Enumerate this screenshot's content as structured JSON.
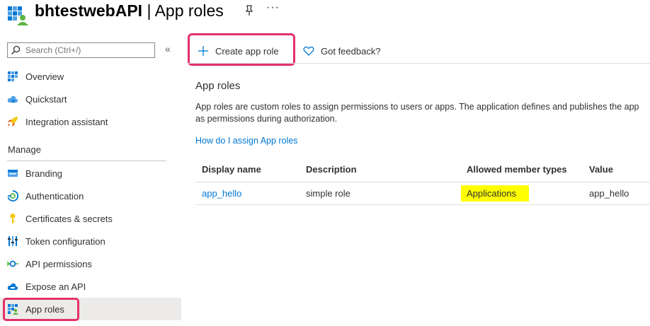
{
  "header": {
    "app_name": "bhtestwebAPI",
    "separator": " | ",
    "page_title": "App roles",
    "more_label": "···"
  },
  "sidebar": {
    "search_placeholder": "Search (Ctrl+/)",
    "collapse_label": "«",
    "items_top": [
      {
        "label": "Overview",
        "icon": "overview-grid-icon"
      },
      {
        "label": "Quickstart",
        "icon": "cloud-icon"
      },
      {
        "label": "Integration assistant",
        "icon": "rocket-icon"
      }
    ],
    "section_label": "Manage",
    "items_manage": [
      {
        "label": "Branding",
        "icon": "branding-icon"
      },
      {
        "label": "Authentication",
        "icon": "authentication-icon"
      },
      {
        "label": "Certificates & secrets",
        "icon": "key-icon"
      },
      {
        "label": "Token configuration",
        "icon": "token-bars-icon"
      },
      {
        "label": "API permissions",
        "icon": "api-permissions-icon"
      },
      {
        "label": "Expose an API",
        "icon": "cloud-api-icon"
      },
      {
        "label": "App roles",
        "icon": "app-roles-icon",
        "active": true
      }
    ]
  },
  "toolbar": {
    "create_label": "Create app role",
    "feedback_label": "Got feedback?"
  },
  "main": {
    "section_title": "App roles",
    "description_line1": "App roles are custom roles to assign permissions to users or apps. The application defines and publishes the app",
    "description_line2": "as permissions during authorization.",
    "help_link": "How do I assign App roles",
    "table": {
      "columns": [
        "Display name",
        "Description",
        "Allowed member types",
        "Value"
      ],
      "rows": [
        {
          "display_name": "app_hello",
          "description": "simple role",
          "allowed_member_types": "Applications",
          "value": "app_hello"
        }
      ]
    }
  },
  "colors": {
    "accent": "#0078d4",
    "highlight_box": "#e3316a",
    "highlight_marker": "#ffff00",
    "active_nav": "#edebe9"
  }
}
